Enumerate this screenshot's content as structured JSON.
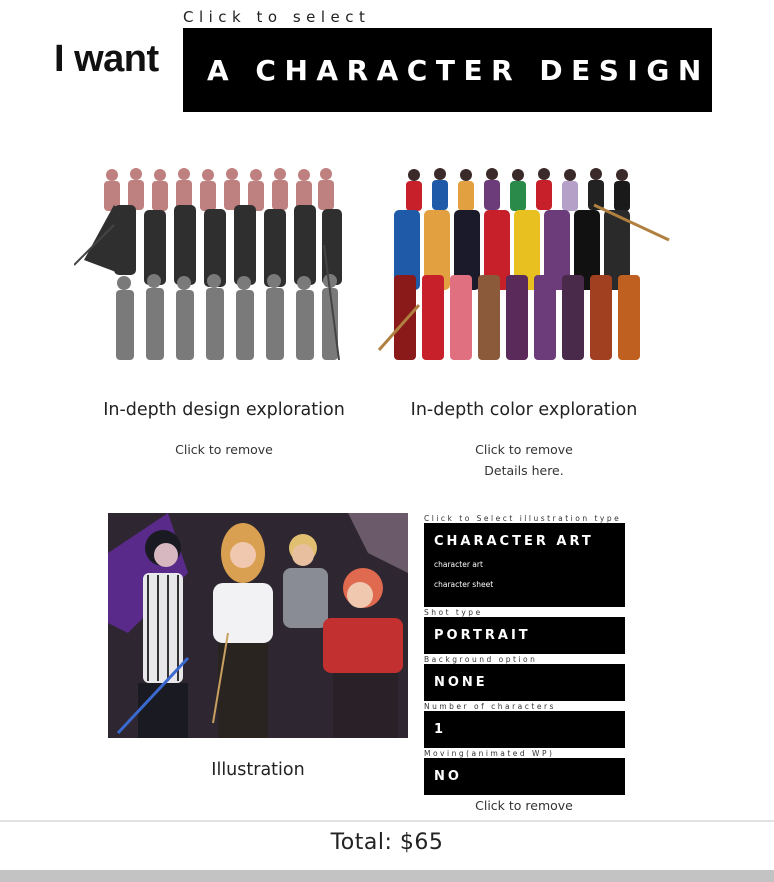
{
  "header": {
    "hint": "Click to select",
    "prefix": "I want",
    "selection": "A CHARACTER DESIGN"
  },
  "options": [
    {
      "title": "In-depth design exploration",
      "remove_label": "Click to remove",
      "image_icon": "character-lineup-grayscale",
      "colors": [
        "#b56a6a",
        "#3a3a3a",
        "#8a8a8a"
      ]
    },
    {
      "title": "In-depth color exploration",
      "remove_label": "Click to remove",
      "details_prefix": "Details ",
      "details_link": "here.",
      "image_icon": "character-lineup-color",
      "colors": [
        "#c8202a",
        "#1e5aa8",
        "#6b3b7a",
        "#e3a040"
      ]
    },
    {
      "title": "Illustration",
      "remove_label": "Click to remove",
      "image_icon": "group-illustration",
      "colors": [
        "#3a2a3a",
        "#e0a0a0",
        "#c23030",
        "#6a3aa0"
      ]
    }
  ],
  "illustration_settings": {
    "type_label": "Click to Select illustration type",
    "type_value": "CHARACTER ART",
    "type_options": [
      "character art",
      "character sheet"
    ],
    "shot_label": "Shot type",
    "shot_value": "PORTRAIT",
    "background_label": "Background option",
    "background_value": "NONE",
    "characters_label": "Number of characters",
    "characters_value": "1",
    "moving_label": "Moving(animated WP)",
    "moving_value": "NO"
  },
  "footer": {
    "total": "Total: $65"
  }
}
